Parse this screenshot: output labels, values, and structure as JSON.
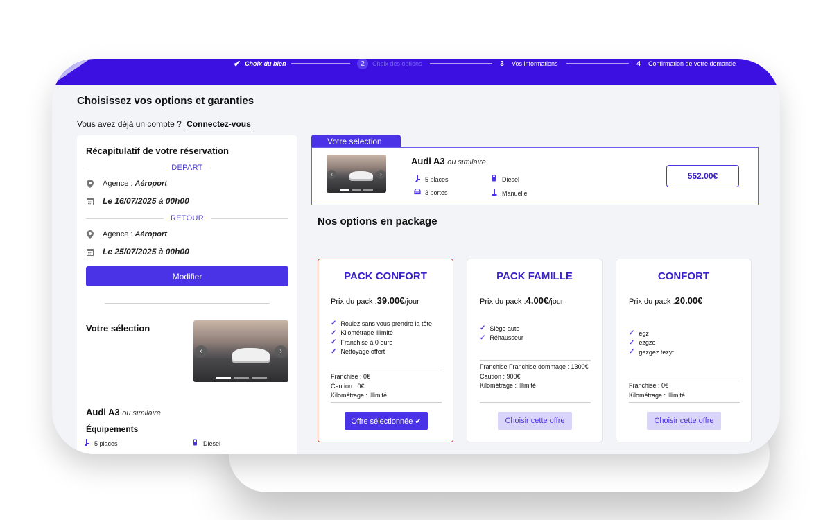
{
  "stepper": {
    "steps": [
      {
        "number": "",
        "label": "Choix du bien",
        "state": "done"
      },
      {
        "number": "2",
        "label": "Choix des options",
        "state": "active"
      },
      {
        "number": "3",
        "label": "Vos informations",
        "state": "pending"
      },
      {
        "number": "4",
        "label": "Confirmation de votre demande",
        "state": "pending"
      }
    ]
  },
  "page": {
    "title": "Choisissez vos options et garanties",
    "account_prompt": "Vous avez déjà un compte ?",
    "login_link": "Connectez-vous"
  },
  "summary": {
    "title": "Récapitulatif de votre réservation",
    "depart_label": "DEPART",
    "depart_agency_prefix": "Agence :",
    "depart_agency": "Aéroport",
    "depart_date": "Le 16/07/2025 à 00h00",
    "return_label": "RETOUR",
    "return_agency_prefix": "Agence :",
    "return_agency": "Aéroport",
    "return_date": "Le 25/07/2025 à 00h00",
    "modify_button": "Modifier",
    "selection_title": "Votre sélection",
    "car_name": "Audi A3",
    "car_similar": "ou similaire",
    "equipment_title": "Équipements",
    "specs": {
      "seats": "5 places",
      "fuel": "Diesel"
    }
  },
  "selection_card": {
    "tab_label": "Votre sélection",
    "car_name": "Audi A3",
    "car_similar": "ou similaire",
    "specs": {
      "seats": "5 places",
      "fuel": "Diesel",
      "doors": "3 portes",
      "gearbox": "Manuelle"
    },
    "price": "552.00€"
  },
  "packages": {
    "title": "Nos options en package",
    "items": [
      {
        "name": "PACK CONFORT",
        "price_prefix": "Prix du pack :",
        "price": "39.00€",
        "unit": "/jour",
        "features": [
          "Roulez sans vous prendre la tête",
          "Kilométrage illimité",
          "Franchise à 0 euro",
          "Nettoyage offert"
        ],
        "meta": [
          "Franchise : 0€",
          "Caution : 0€",
          "Kilométrage : Illimité"
        ],
        "button": "Offre sélectionnée ✔",
        "selected": true
      },
      {
        "name": "PACK FAMILLE",
        "price_prefix": "Prix du pack :",
        "price": "4.00€",
        "unit": "/jour",
        "features": [
          "Siège auto",
          "Réhausseur"
        ],
        "meta": [
          "Franchise Franchise dommage : 1300€",
          "Caution : 900€",
          "Kilométrage : Illimité"
        ],
        "button": "Choisir cette offre",
        "selected": false
      },
      {
        "name": "CONFORT",
        "price_prefix": "Prix du pack :",
        "price": "20.00€",
        "unit": "",
        "features": [
          "egz",
          "ezgze",
          "gezgez tezyt"
        ],
        "meta": [
          "Franchise : 0€",
          "Kilométrage : Illimité"
        ],
        "button": "Choisir cette offre",
        "selected": false
      }
    ]
  },
  "colors": {
    "primary": "#4a33e6",
    "header": "#3b10e0",
    "selected_border": "#d84a3a"
  }
}
